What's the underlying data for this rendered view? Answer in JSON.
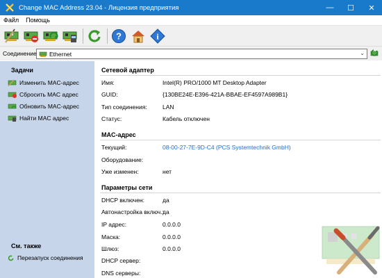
{
  "window": {
    "title": "Change MAC Address 23.04 - Лицензия предприятия",
    "minimize": "—",
    "maximize": "☐",
    "close": "✕"
  },
  "menu": {
    "items": [
      "Файл",
      "Помощь"
    ]
  },
  "toolbar": {
    "buttons": [
      "change-mac",
      "reset-mac",
      "update-mac",
      "find-mac",
      "restart",
      "help",
      "home",
      "info"
    ]
  },
  "connection": {
    "label": "Соединение:",
    "value": "Ethernet"
  },
  "sidebar": {
    "tasks_title": "Задачи",
    "tasks": [
      "Изменить MAC-адрес",
      "Сбросить MAC адрес",
      "Обновить MAC-адрес",
      "Найти MAC адрес"
    ],
    "also_title": "См. также",
    "also": [
      "Перезапуск соединения"
    ]
  },
  "adapter": {
    "title": "Сетевой адаптер",
    "rows": [
      {
        "label": "Имя:",
        "value": "Intel(R) PRO/1000 MT Desktop Adapter"
      },
      {
        "label": "GUID:",
        "value": "{130BE24E-E396-421A-BBAE-EF4597A989B1}"
      },
      {
        "label": "Тип соединения:",
        "value": "LAN"
      },
      {
        "label": "Статус:",
        "value": "Кабель отключен"
      }
    ]
  },
  "mac": {
    "title": "MAC-адрес",
    "rows": [
      {
        "label": "Текущий:",
        "value": "08-00-27-7E-9D-C4 (PCS Systemtechnik GmbH)"
      },
      {
        "label": "Оборудование:",
        "value": ""
      },
      {
        "label": "Уже изменен:",
        "value": "нет"
      }
    ]
  },
  "network": {
    "title": "Параметры сети",
    "rows": [
      {
        "label": "DHCP включен:",
        "value": "да"
      },
      {
        "label": "Автонастройка включ.:",
        "value": "да"
      },
      {
        "label": "IP адрес:",
        "value": "0.0.0.0"
      },
      {
        "label": "Маска:",
        "value": "0.0.0.0"
      },
      {
        "label": "Шлюз:",
        "value": "0.0.0.0"
      },
      {
        "label": "DHCP сервер:",
        "value": ""
      },
      {
        "label": "DNS серверы:",
        "value": ""
      }
    ]
  },
  "colors": {
    "titlebar": "#1979ca",
    "sidebar": "#c6d5ea",
    "link": "#1f6ecb"
  }
}
